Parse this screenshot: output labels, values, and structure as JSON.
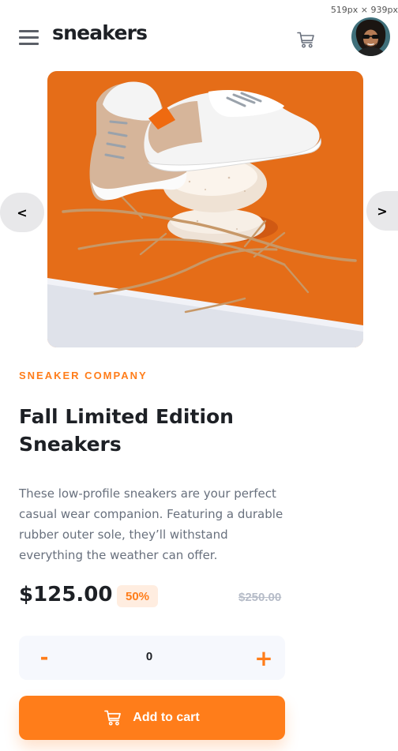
{
  "viewport_badge": "519px × 939px",
  "header": {
    "logo": "sneakers",
    "menu_icon": "hamburger-menu-icon",
    "cart_icon": "cart-icon",
    "avatar": "user-avatar"
  },
  "gallery": {
    "prev_label": "<",
    "next_label": ">",
    "image": "sneakers-on-stones-product-photo"
  },
  "product": {
    "company": "SNEAKER COMPANY",
    "title": "Fall Limited Edition Sneakers",
    "description": "These low-profile sneakers are your perfect casual wear companion. Featuring a durable rubber outer sole, they’ll withstand everything the weather can offer.",
    "price": "$125.00",
    "discount": "50%",
    "old_price": "$250.00"
  },
  "quantity": {
    "minus_label": "-",
    "value": "0",
    "plus_label": "+"
  },
  "add_to_cart": {
    "label": "Add to cart",
    "icon": "cart-icon"
  },
  "colors": {
    "accent": "#ff7d1a",
    "accent_pale": "#ffede0",
    "text_dark": "#1d2025",
    "text_gray": "#68707d",
    "text_light": "#b6bcc8",
    "panel": "#f6f8fd"
  }
}
